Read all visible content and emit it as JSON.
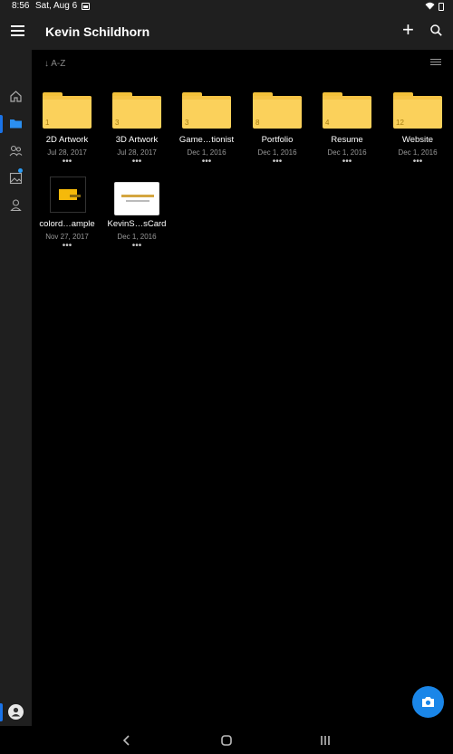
{
  "status_bar": {
    "time": "8:56",
    "date": "Sat, Aug 6"
  },
  "app_bar": {
    "title": "Kevin Schildhorn"
  },
  "sort": {
    "label": "↓ A-Z"
  },
  "items": [
    {
      "name": "2D Artwork",
      "date": "Jul 28, 2017",
      "count": "1"
    },
    {
      "name": "3D Artwork",
      "date": "Jul 28, 2017",
      "count": "3"
    },
    {
      "name": "Game…tionist",
      "date": "Dec 1, 2016",
      "count": "3"
    },
    {
      "name": "Portfolio",
      "date": "Dec 1, 2016",
      "count": "8"
    },
    {
      "name": "Resume",
      "date": "Dec 1, 2016",
      "count": "4"
    },
    {
      "name": "Website",
      "date": "Dec 1, 2016",
      "count": "12"
    },
    {
      "name": "colord…ample",
      "date": "Nov 27, 2017"
    },
    {
      "name": "KevinS…sCard",
      "date": "Dec 1, 2016"
    }
  ],
  "more_label": "•••",
  "colors": {
    "accent": "#1a86e8",
    "folder": "#fbd15b",
    "surface": "#1f1f1f",
    "background": "#000000"
  },
  "icons": [
    "menu-icon",
    "add-icon",
    "search-icon",
    "home-icon",
    "folder-icon",
    "people-icon",
    "photos-icon",
    "person-icon",
    "view-options-icon",
    "camera-icon",
    "back-icon",
    "home-nav-icon",
    "recents-icon"
  ]
}
